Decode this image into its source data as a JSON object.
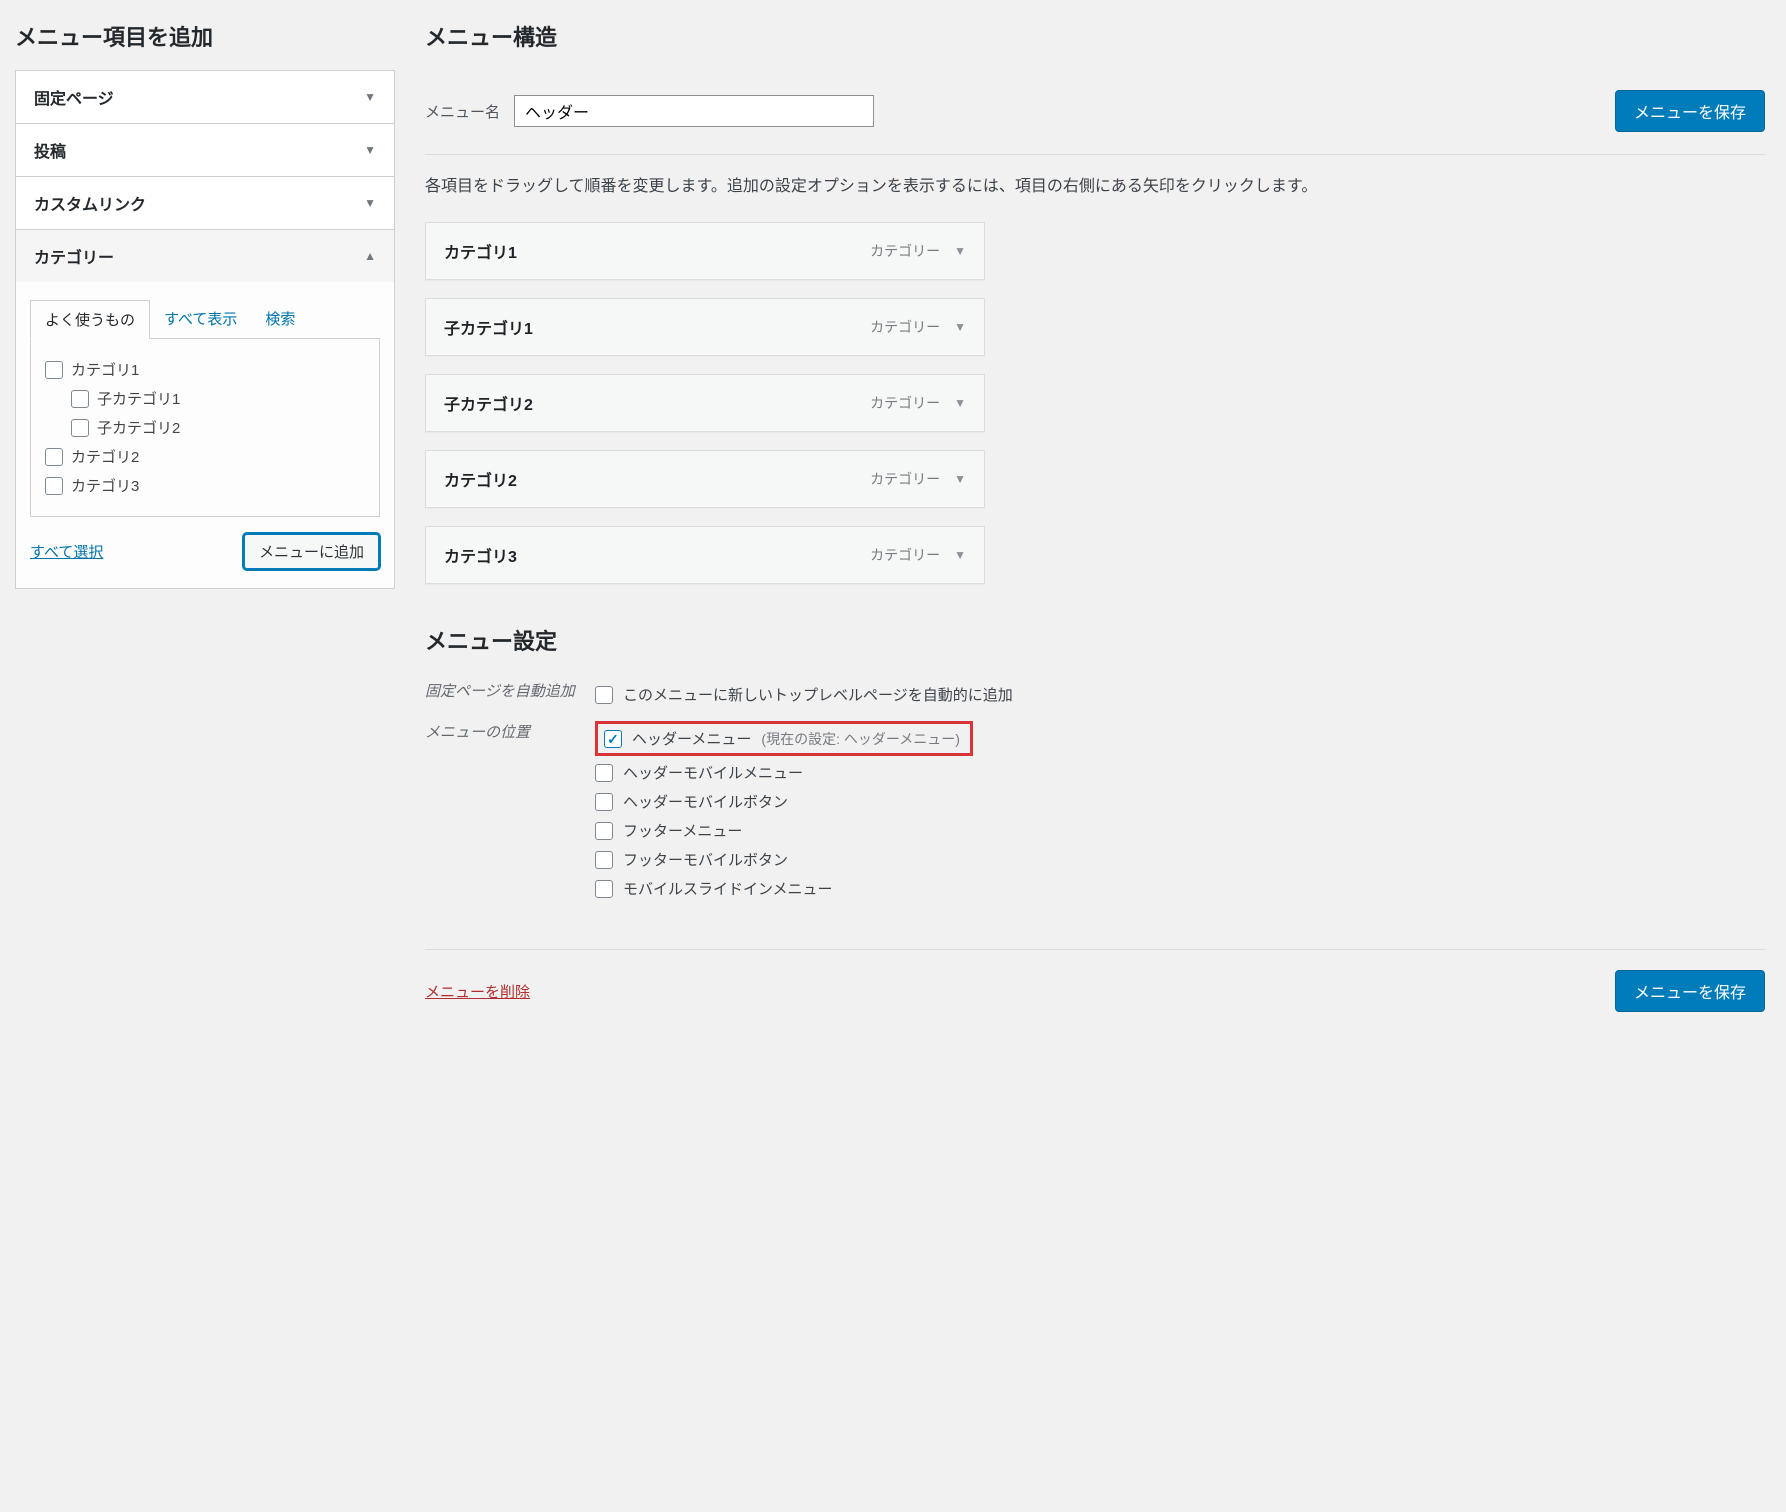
{
  "left": {
    "title": "メニュー項目を追加",
    "metaboxes": {
      "pages": "固定ページ",
      "posts": "投稿",
      "custom_links": "カスタムリンク",
      "categories": "カテゴリー"
    },
    "tabs": {
      "most_used": "よく使うもの",
      "view_all": "すべて表示",
      "search": "検索"
    },
    "category_items": [
      {
        "label": "カテゴリ1",
        "indent": false
      },
      {
        "label": "子カテゴリ1",
        "indent": true
      },
      {
        "label": "子カテゴリ2",
        "indent": true
      },
      {
        "label": "カテゴリ2",
        "indent": false
      },
      {
        "label": "カテゴリ3",
        "indent": false
      }
    ],
    "select_all": "すべて選択",
    "add_to_menu": "メニューに追加"
  },
  "right": {
    "title": "メニュー構造",
    "menu_name_label": "メニュー名",
    "menu_name_value": "ヘッダー",
    "save_menu": "メニューを保存",
    "help": "各項目をドラッグして順番を変更します。追加の設定オプションを表示するには、項目の右側にある矢印をクリックします。",
    "type_label": "カテゴリー",
    "items": [
      {
        "title": "カテゴリ1"
      },
      {
        "title": "子カテゴリ1"
      },
      {
        "title": "子カテゴリ2"
      },
      {
        "title": "カテゴリ2"
      },
      {
        "title": "カテゴリ3"
      }
    ],
    "settings": {
      "heading": "メニュー設定",
      "auto_add_label": "固定ページを自動追加",
      "auto_add_text": "このメニューに新しいトップレベルページを自動的に追加",
      "location_label": "メニューの位置",
      "locations": [
        {
          "label": "ヘッダーメニュー",
          "note": "(現在の設定: ヘッダーメニュー)",
          "checked": true,
          "highlight": true
        },
        {
          "label": "ヘッダーモバイルメニュー",
          "checked": false
        },
        {
          "label": "ヘッダーモバイルボタン",
          "checked": false
        },
        {
          "label": "フッターメニュー",
          "checked": false
        },
        {
          "label": "フッターモバイルボタン",
          "checked": false
        },
        {
          "label": "モバイルスライドインメニュー",
          "checked": false
        }
      ]
    },
    "delete_menu": "メニューを削除"
  }
}
